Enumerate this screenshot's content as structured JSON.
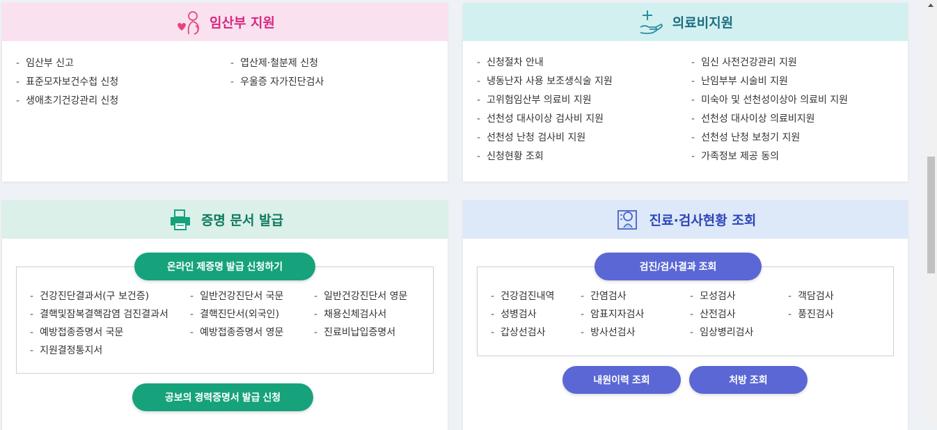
{
  "cards": {
    "pregnancy": {
      "title": "임산부 지원",
      "icon": "pregnant-woman-icon",
      "color": "#d6287e",
      "bg": "#f9e1ef",
      "col1": [
        "임산부 신고",
        "표준모자보건수첩 신청",
        "생애초기건강관리 신청"
      ],
      "col2": [
        "엽산제·철분제 신청",
        "우울증 자가진단검사"
      ]
    },
    "medical": {
      "title": "의료비지원",
      "icon": "hand-plus-icon",
      "color": "#1a6e80",
      "bg": "#d3f0f0",
      "col1": [
        "신청절차 안내",
        "냉동난자 사용 보조생식술 지원",
        "고위험임산부 의료비 지원",
        "선천성 대사이상 검사비 지원",
        "선천성 난청 검사비 지원",
        "신청현황 조회"
      ],
      "col2": [
        "임신 사전건강관리 지원",
        "난임부부 시술비 지원",
        "미숙아 및 선천성이상아 의료비 지원",
        "선천성 대사이상 의료비지원",
        "선천성 난청 보청기 지원",
        "가족정보 제공 동의"
      ]
    },
    "certificate": {
      "title": "증명 문서 발급",
      "icon": "printer-icon",
      "color": "#0f7a5e",
      "bg": "#daf0e9",
      "apply_button": "온라인 제증명 발급 신청하기",
      "col1": [
        "건강진단결과서(구 보건증)",
        "결핵및잠복결핵감염 검진결과서",
        "예방접종증명서 국문",
        "지원결정통지서"
      ],
      "col2": [
        "일반건강진단서 국문",
        "결핵진단서(외국인)",
        "예방접종증명서 영문"
      ],
      "col3": [
        "일반건강진단서 영문",
        "채용신체검사서",
        "진료비납입증명서"
      ],
      "bottom_button": "공보의 경력증명서 발급 신청"
    },
    "results": {
      "title": "진료·검사현황 조회",
      "icon": "document-search-icon",
      "color": "#2d45b8",
      "bg": "#dde8f8",
      "apply_button": "검진/검사결과 조회",
      "col1": [
        "건강검진내역",
        "성병검사",
        "갑상선검사"
      ],
      "col2": [
        "간염검사",
        "암표지자검사",
        "방사선검사"
      ],
      "col3": [
        "모성검사",
        "산전검사",
        "임상병리검사"
      ],
      "col4": [
        "객담검사",
        "풍진검사"
      ],
      "visit_button": "내원이력 조회",
      "prescription_button": "처방 조회"
    }
  }
}
